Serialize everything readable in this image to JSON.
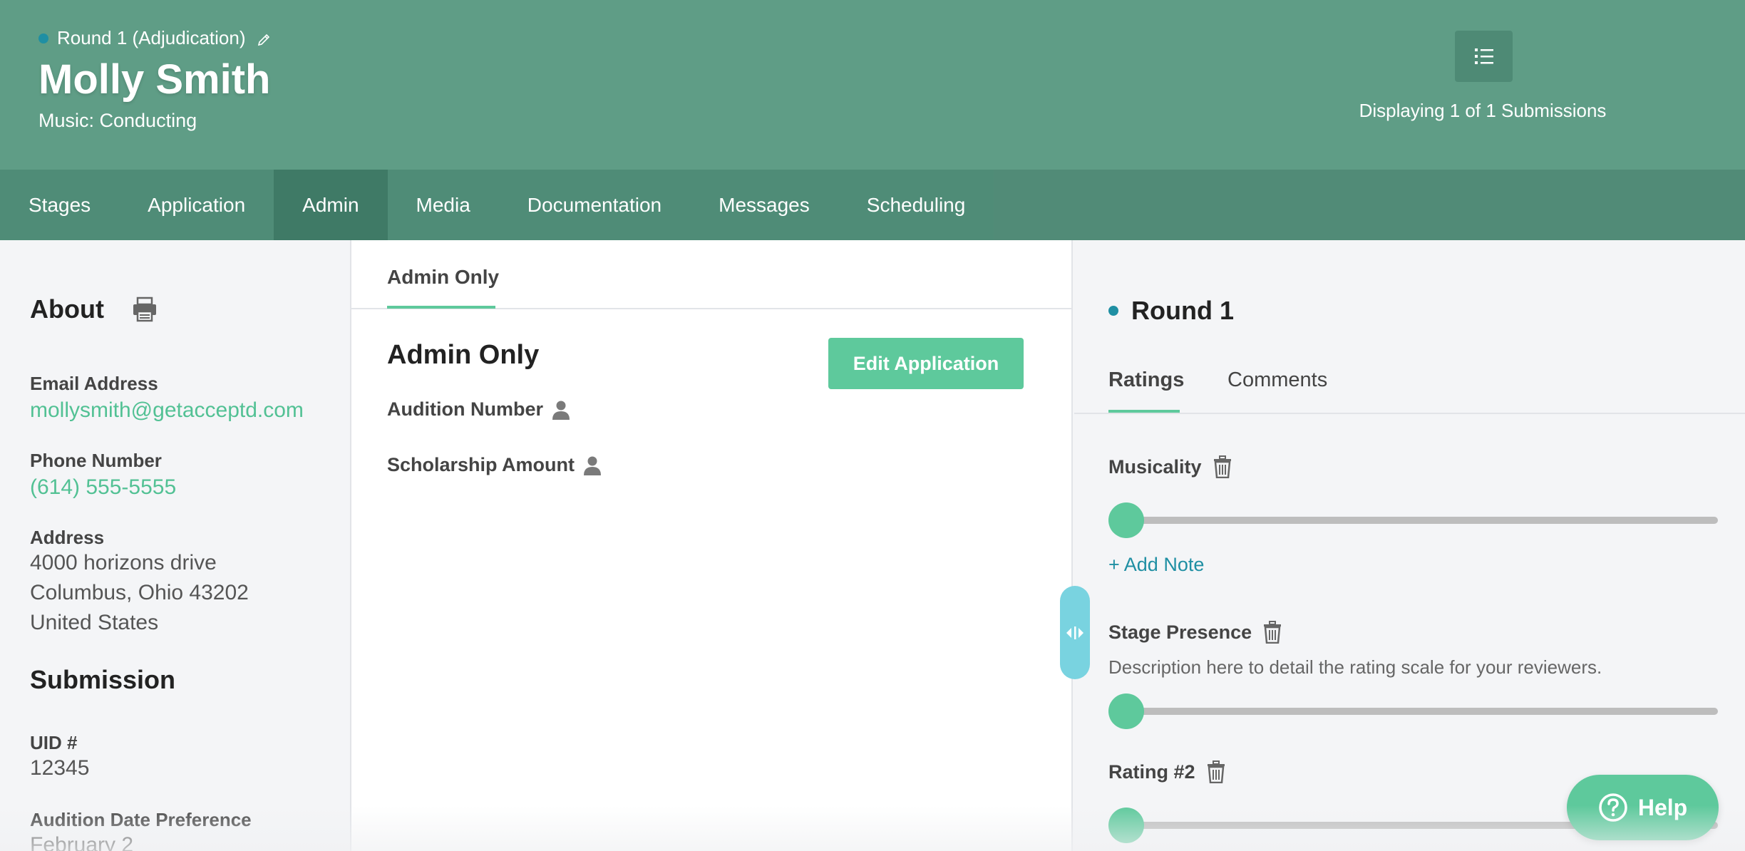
{
  "header": {
    "round_label": "Round 1 (Adjudication)",
    "student_name": "Molly Smith",
    "program": "Music: Conducting",
    "displaying": "Displaying 1 of 1 Submissions"
  },
  "nav": {
    "tabs": [
      {
        "label": "Stages"
      },
      {
        "label": "Application"
      },
      {
        "label": "Admin"
      },
      {
        "label": "Media"
      },
      {
        "label": "Documentation"
      },
      {
        "label": "Messages"
      },
      {
        "label": "Scheduling"
      }
    ],
    "active": "Admin"
  },
  "about": {
    "title": "About",
    "email_label": "Email Address",
    "email": "mollysmith@getacceptd.com",
    "phone_label": "Phone Number",
    "phone": "(614) 555-5555",
    "address_label": "Address",
    "address_line1": "4000 horizons drive",
    "address_line2": "Columbus, Ohio 43202",
    "address_line3": "United States"
  },
  "submission": {
    "title": "Submission",
    "uid_label": "UID #",
    "uid": "12345",
    "date_pref_label": "Audition Date Preference",
    "date_pref": "February 2"
  },
  "admin": {
    "tab_label": "Admin Only",
    "heading": "Admin Only",
    "edit_button": "Edit Application",
    "fields": [
      {
        "label": "Audition Number"
      },
      {
        "label": "Scholarship Amount"
      }
    ]
  },
  "review": {
    "round_title": "Round 1",
    "tabs": {
      "ratings": "Ratings",
      "comments": "Comments"
    },
    "active_tab": "Ratings",
    "ratings": [
      {
        "label": "Musicality",
        "value": 0
      },
      {
        "label": "Stage Presence",
        "description": "Description here to detail the rating scale for your reviewers.",
        "value": 0
      },
      {
        "label": "Rating #2",
        "value": 0
      }
    ],
    "add_note": "+ Add Note"
  },
  "help": {
    "label": "Help"
  },
  "colors": {
    "header_bg": "#5f9d86",
    "nav_active": "#3f7a66",
    "accent_green": "#5ec99c",
    "link_teal": "#1f8fa3",
    "handle": "#79d3e0"
  }
}
